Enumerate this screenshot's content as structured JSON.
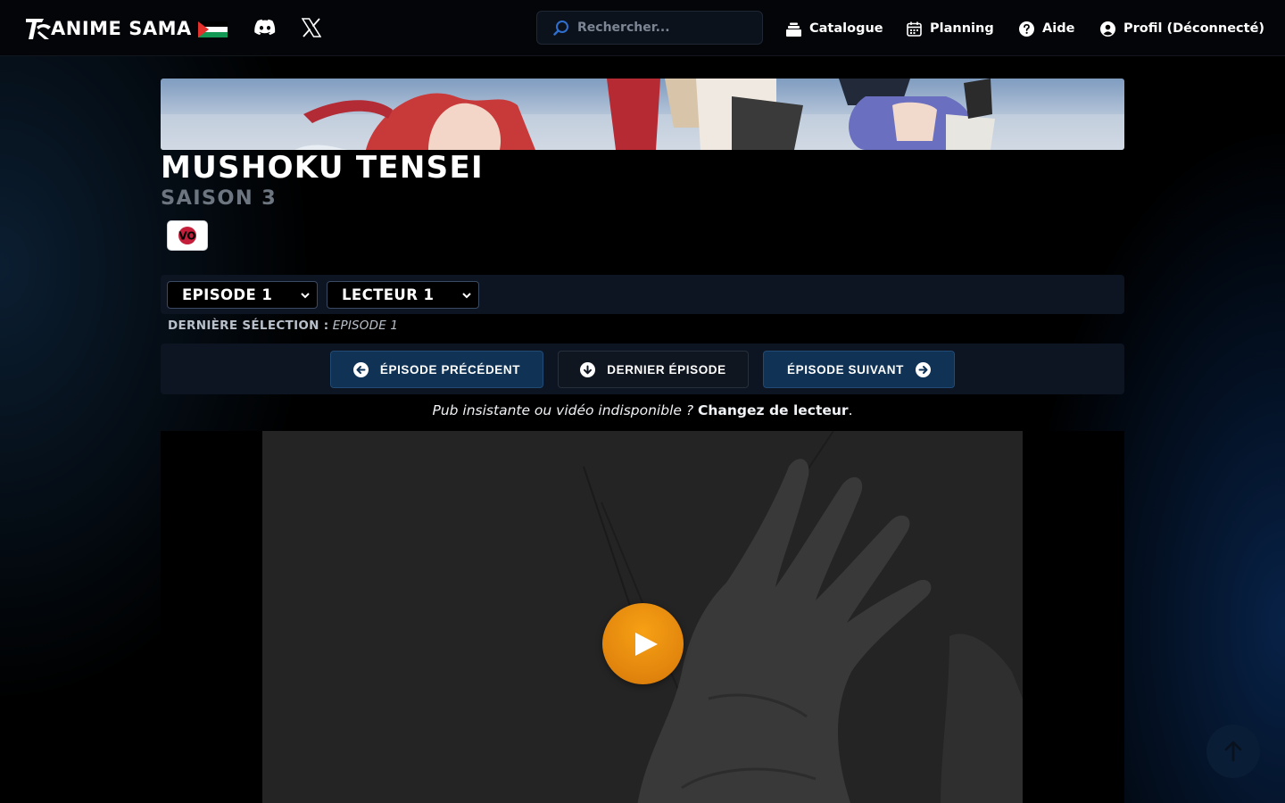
{
  "site": {
    "logo_text": "ANIME SAMA"
  },
  "search": {
    "placeholder": "Rechercher..."
  },
  "nav": {
    "catalogue": "Catalogue",
    "planning": "Planning",
    "aide": "Aide",
    "profil": "Profil (Déconnecté)"
  },
  "anime": {
    "title": "MUSHOKU TENSEI",
    "season": "SAISON 3",
    "language_badge": "VO"
  },
  "selectors": {
    "episode": {
      "selected": "EPISODE 1"
    },
    "lecteur": {
      "selected": "LECTEUR 1"
    }
  },
  "last_selection": {
    "label": "DERNIÈRE SÉLECTION :",
    "value": "EPISODE 1"
  },
  "episode_nav": {
    "previous": "ÉPISODE PRÉCÉDENT",
    "last": "DERNIER ÉPISODE",
    "next": "ÉPISODE SUIVANT"
  },
  "player_note": {
    "text": "Pub insistante ou vidéo indisponible ?",
    "link": "Changez de lecteur",
    "end": "."
  },
  "icons": {
    "flag": "palestine-flag-icon",
    "discord": "discord-icon",
    "x": "x-twitter-icon",
    "search": "search-icon",
    "catalogue": "catalogue-icon",
    "planning": "calendar-icon",
    "aide": "help-icon",
    "profil": "user-icon",
    "previous": "arrow-left-circle-icon",
    "last": "arrow-down-circle-icon",
    "next": "arrow-right-circle-icon",
    "play": "play-icon",
    "scroll_top": "arrow-up-icon"
  },
  "colors": {
    "accent_blue": "#0f3255",
    "play_orange": "#f39c12",
    "panel": "#0d1523",
    "muted_text": "#6c7580"
  }
}
